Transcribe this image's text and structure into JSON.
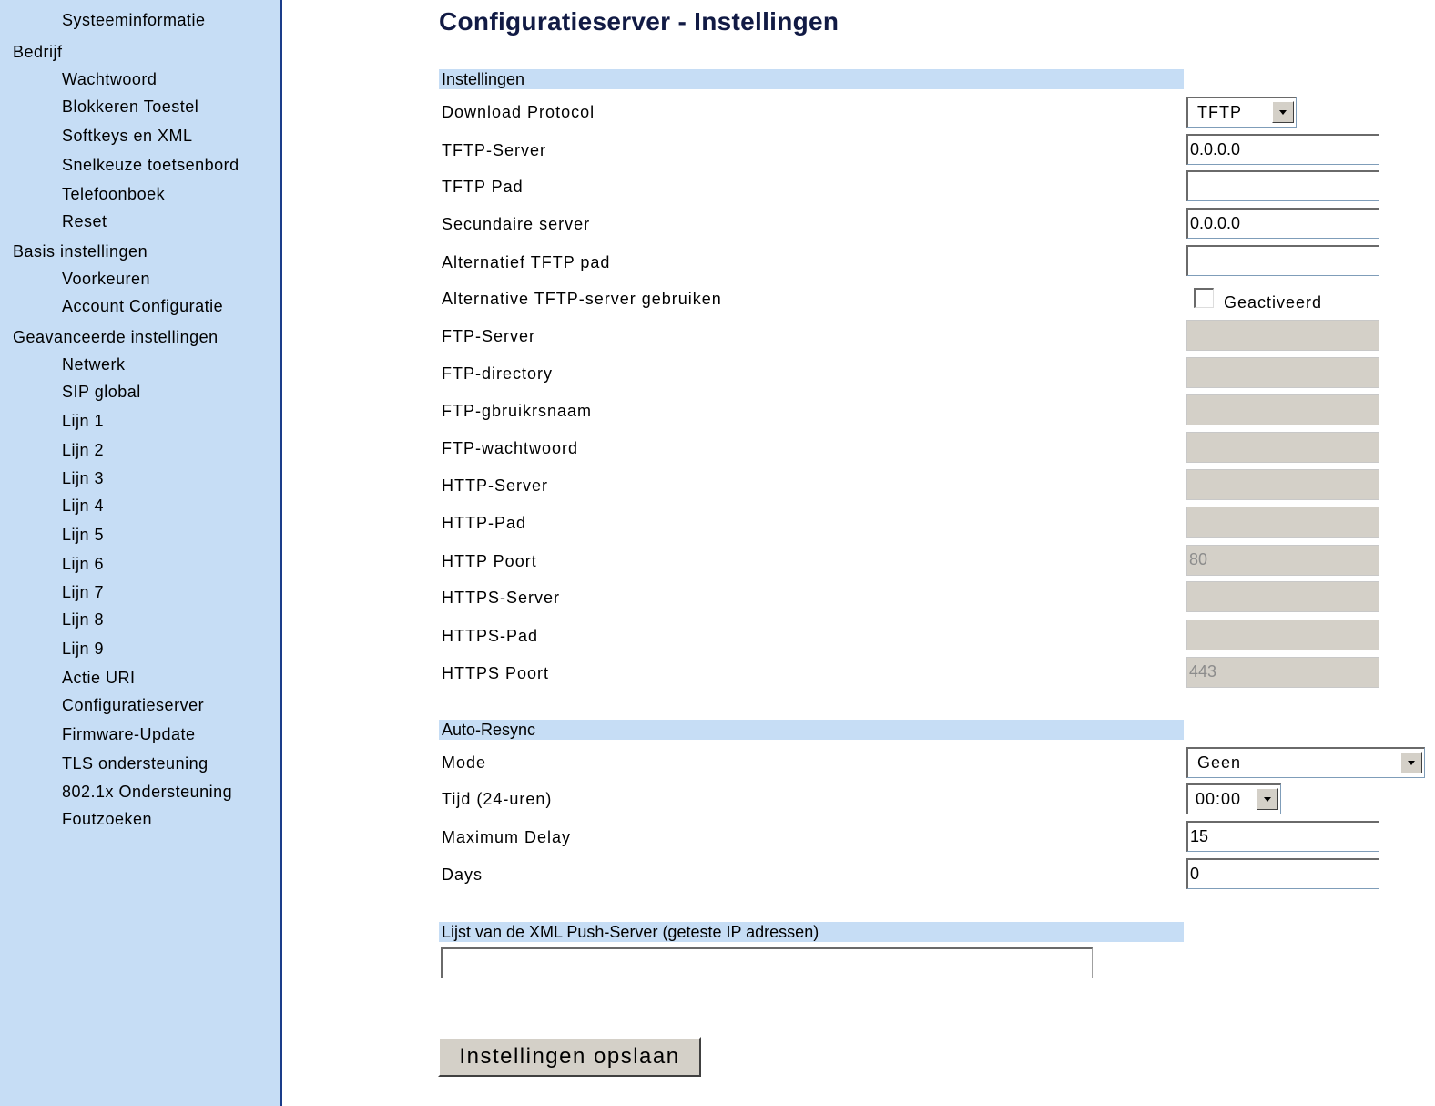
{
  "sidebar": {
    "items": [
      {
        "label": "Systeeminformatie",
        "level": 2
      },
      {
        "label": "Bedrijf",
        "level": 1
      },
      {
        "label": "Wachtwoord",
        "level": 2
      },
      {
        "label": "Blokkeren Toestel",
        "level": 2
      },
      {
        "label": "Softkeys en XML",
        "level": 2
      },
      {
        "label": "Snelkeuze toetsenbord",
        "level": 2
      },
      {
        "label": "Telefoonboek",
        "level": 2
      },
      {
        "label": "Reset",
        "level": 2
      },
      {
        "label": "Basis instellingen",
        "level": 1
      },
      {
        "label": "Voorkeuren",
        "level": 2
      },
      {
        "label": "Account Configuratie",
        "level": 2
      },
      {
        "label": "Geavanceerde instellingen",
        "level": 1
      },
      {
        "label": "Netwerk",
        "level": 2
      },
      {
        "label": "SIP global",
        "level": 2
      },
      {
        "label": "Lijn 1",
        "level": 2
      },
      {
        "label": "Lijn 2",
        "level": 2
      },
      {
        "label": "Lijn 3",
        "level": 2
      },
      {
        "label": "Lijn 4",
        "level": 2
      },
      {
        "label": "Lijn 5",
        "level": 2
      },
      {
        "label": "Lijn 6",
        "level": 2
      },
      {
        "label": "Lijn 7",
        "level": 2
      },
      {
        "label": "Lijn 8",
        "level": 2
      },
      {
        "label": "Lijn 9",
        "level": 2
      },
      {
        "label": "Actie URI",
        "level": 2
      },
      {
        "label": "Configuratieserver",
        "level": 2
      },
      {
        "label": "Firmware-Update",
        "level": 2
      },
      {
        "label": "TLS ondersteuning",
        "level": 2
      },
      {
        "label": "802.1x Ondersteuning",
        "level": 2
      },
      {
        "label": "Foutzoeken",
        "level": 2
      }
    ]
  },
  "page": {
    "title": "Configuratieserver - Instellingen"
  },
  "settings": {
    "header": "Instellingen",
    "download_protocol": {
      "label": "Download Protocol",
      "value": "TFTP"
    },
    "tftp_server": {
      "label": "TFTP-Server",
      "value": "0.0.0.0"
    },
    "tftp_path": {
      "label": "TFTP Pad",
      "value": ""
    },
    "secondary_server": {
      "label": "Secundaire server",
      "value": "0.0.0.0"
    },
    "alt_tftp_path": {
      "label": "Alternatief TFTP pad",
      "value": ""
    },
    "alt_tftp_server": {
      "label": "Alternative TFTP-server gebruiken",
      "checkbox_label": "Geactiveerd",
      "checked": false
    },
    "ftp_server": {
      "label": "FTP-Server",
      "value": ""
    },
    "ftp_directory": {
      "label": "FTP-directory",
      "value": ""
    },
    "ftp_username": {
      "label": "FTP-gbruikrsnaam",
      "value": ""
    },
    "ftp_password": {
      "label": "FTP-wachtwoord",
      "value": ""
    },
    "http_server": {
      "label": "HTTP-Server",
      "value": ""
    },
    "http_path": {
      "label": "HTTP-Pad",
      "value": ""
    },
    "http_port": {
      "label": "HTTP Poort",
      "value": "80"
    },
    "https_server": {
      "label": "HTTPS-Server",
      "value": ""
    },
    "https_path": {
      "label": "HTTPS-Pad",
      "value": ""
    },
    "https_port": {
      "label": "HTTPS Poort",
      "value": "443"
    }
  },
  "auto_resync": {
    "header": "Auto-Resync",
    "mode": {
      "label": "Mode",
      "value": "Geen"
    },
    "time": {
      "label": "Tijd (24-uren)",
      "value": "00:00"
    },
    "max_delay": {
      "label": "Maximum Delay",
      "value": "15"
    },
    "days": {
      "label": "Days",
      "value": "0"
    }
  },
  "xml_push": {
    "header": "Lijst van de XML Push-Server (geteste IP adressen)",
    "value": ""
  },
  "save_button": "Instellingen opslaan",
  "colors": {
    "sidebar_bg": "#c6ddf5",
    "sidebar_border": "#1a3c8a",
    "title": "#111a44",
    "disabled_field": "#d4d0c8"
  }
}
